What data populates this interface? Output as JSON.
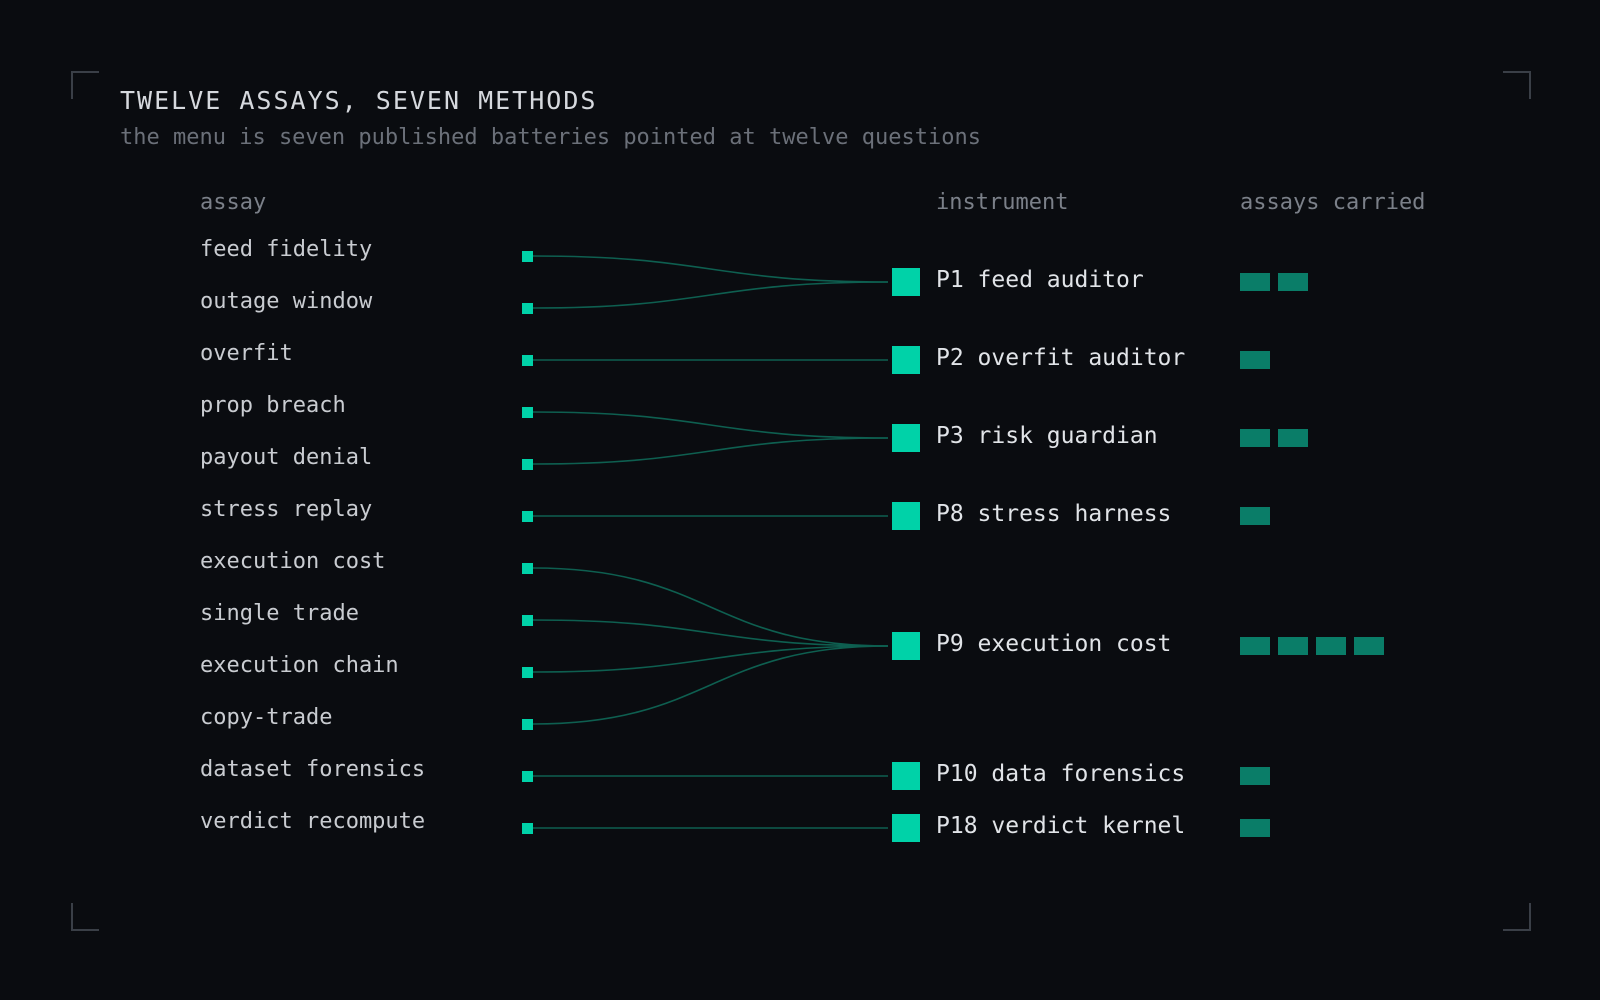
{
  "title": "TWELVE ASSAYS, SEVEN METHODS",
  "subtitle": "the menu is seven published batteries pointed at twelve questions",
  "columns": {
    "assay": "assay",
    "instrument": "instrument",
    "assays_carried": "assays carried"
  },
  "colors": {
    "background": "#0a0c10",
    "accent": "#00d2a8",
    "chip": "#0a7d68",
    "connector": "#0e5f50"
  },
  "assays": [
    {
      "label": "feed fidelity",
      "instrument": 0
    },
    {
      "label": "outage window",
      "instrument": 0
    },
    {
      "label": "overfit",
      "instrument": 1
    },
    {
      "label": "prop breach",
      "instrument": 2
    },
    {
      "label": "payout denial",
      "instrument": 2
    },
    {
      "label": "stress replay",
      "instrument": 3
    },
    {
      "label": "execution cost",
      "instrument": 4
    },
    {
      "label": "single trade",
      "instrument": 4
    },
    {
      "label": "execution chain",
      "instrument": 4
    },
    {
      "label": "copy-trade",
      "instrument": 4
    },
    {
      "label": "dataset forensics",
      "instrument": 5
    },
    {
      "label": "verdict recompute",
      "instrument": 6
    }
  ],
  "instruments": [
    {
      "label": "P1 feed auditor",
      "assays_carried": 2
    },
    {
      "label": "P2 overfit auditor",
      "assays_carried": 1
    },
    {
      "label": "P3 risk guardian",
      "assays_carried": 2
    },
    {
      "label": "P8 stress harness",
      "assays_carried": 1
    },
    {
      "label": "P9 execution cost",
      "assays_carried": 4
    },
    {
      "label": "P10 data forensics",
      "assays_carried": 1
    },
    {
      "label": "P18 verdict kernel",
      "assays_carried": 1
    }
  ]
}
